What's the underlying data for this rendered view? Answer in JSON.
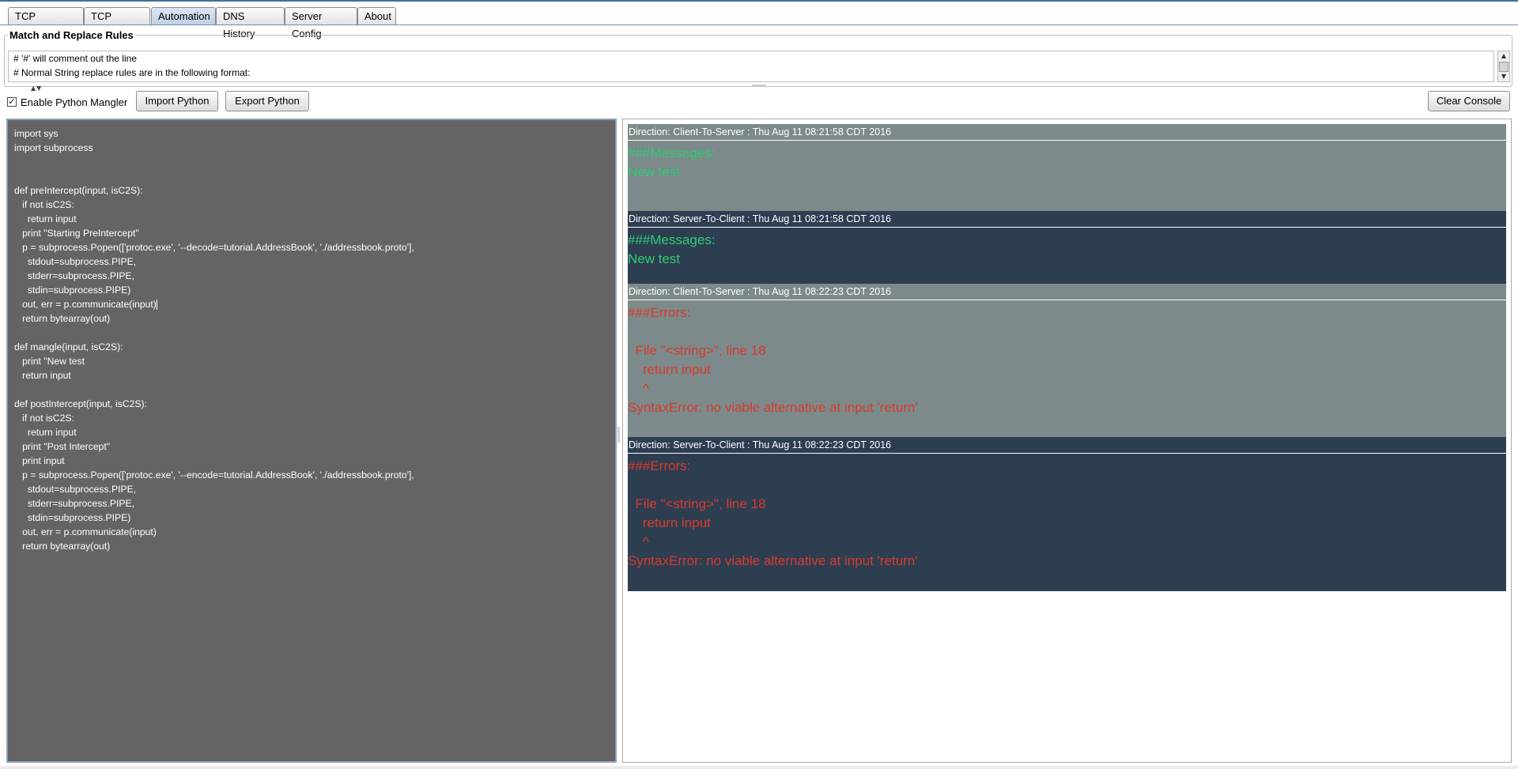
{
  "tabs": [
    {
      "label": "TCP Intercept",
      "active": false
    },
    {
      "label": "TCP History",
      "active": false
    },
    {
      "label": "Automation",
      "active": true
    },
    {
      "label": "DNS History",
      "active": false
    },
    {
      "label": "Server Config",
      "active": false
    },
    {
      "label": "About",
      "active": false
    }
  ],
  "match_replace": {
    "title": "Match and Replace Rules",
    "lines": [
      "# '#' will comment out the line",
      "# Normal String replace rules are in the following format:"
    ]
  },
  "toolbar": {
    "enable_python_label": "Enable Python Mangler",
    "enable_python_checked": true,
    "import_label": "Import Python",
    "export_label": "Export Python",
    "clear_console_label": "Clear Console"
  },
  "editor": {
    "lines": [
      "import sys",
      "import subprocess",
      "",
      "",
      "def preIntercept(input, isC2S):",
      "   if not isC2S:",
      "     return input",
      "   print \"Starting PreIntercept\"",
      "   p = subprocess.Popen(['protoc.exe', '--decode=tutorial.AddressBook', './addressbook.proto'],",
      "     stdout=subprocess.PIPE,",
      "     stderr=subprocess.PIPE,",
      "     stdin=subprocess.PIPE)",
      "   out, err = p.communicate(input)",
      "   return bytearray(out)",
      "",
      "def mangle(input, isC2S):",
      "   print \"New test",
      "   return input",
      "",
      "def postIntercept(input, isC2S):",
      "   if not isC2S:",
      "     return input",
      "   print \"Post Intercept\"",
      "   print input",
      "   p = subprocess.Popen(['protoc.exe', '--encode=tutorial.AddressBook', './addressbook.proto'],",
      "     stdout=subprocess.PIPE,",
      "     stderr=subprocess.PIPE,",
      "     stdin=subprocess.PIPE)",
      "   out, err = p.communicate(input)",
      "   return bytearray(out)"
    ],
    "caret_line": 12
  },
  "console": {
    "entries": [
      {
        "header": "Direction: Client-To-Server : Thu Aug 11 08:21:58 CDT 2016",
        "theme": "gray",
        "tone": "green",
        "body": "###Messages:\nNew test"
      },
      {
        "header": "Direction: Server-To-Client : Thu Aug 11 08:21:58 CDT 2016",
        "theme": "dark",
        "tone": "green",
        "body": "###Messages:\nNew test"
      },
      {
        "header": "Direction: Client-To-Server : Thu Aug 11 08:22:23 CDT 2016",
        "theme": "gray",
        "tone": "red",
        "body": "###Errors:\n\n  File \"<string>\", line 18\n    return input\n    ^\nSyntaxError: no viable alternative at input 'return'"
      },
      {
        "header": "Direction: Server-To-Client : Thu Aug 11 08:22:23 CDT 2016",
        "theme": "dark",
        "tone": "red",
        "body": "###Errors:\n\n  File \"<string>\", line 18\n    return input\n    ^\nSyntaxError: no viable alternative at input 'return'"
      }
    ]
  }
}
